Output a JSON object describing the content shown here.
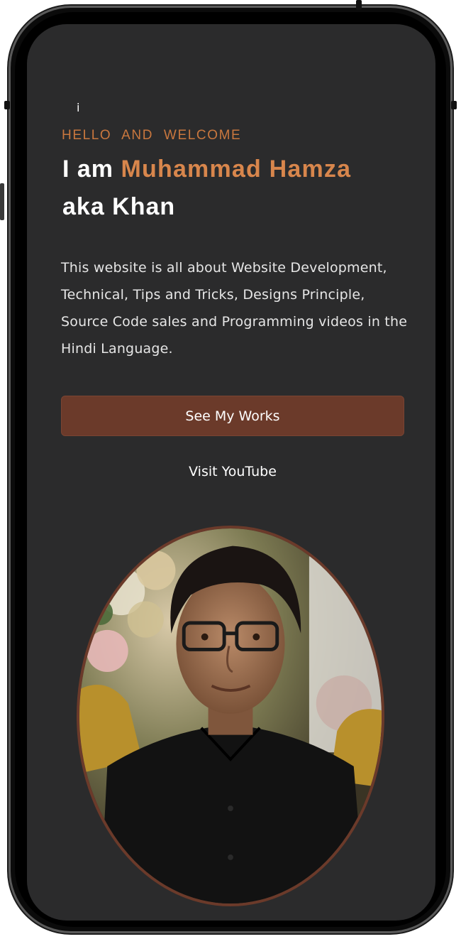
{
  "hero": {
    "cursor_glyph": "i",
    "greeting": "HELLO AND WELCOME",
    "intro_prefix": "I am ",
    "name": "Muhammad Hamza",
    "alias": "aka Khan",
    "description": "This website is all about Website Development, Technical, Tips and Tricks, Designs Principle, Source Code sales and Programming videos in the Hindi Language.",
    "primary_button": "See My Works",
    "secondary_link": "Visit YouTube"
  },
  "colors": {
    "screen_bg": "#2b2b2c",
    "accent": "#d8864c",
    "button_bg": "#6b3a2a",
    "text": "#ffffff"
  },
  "portrait": {
    "icon": "profile-photo"
  }
}
